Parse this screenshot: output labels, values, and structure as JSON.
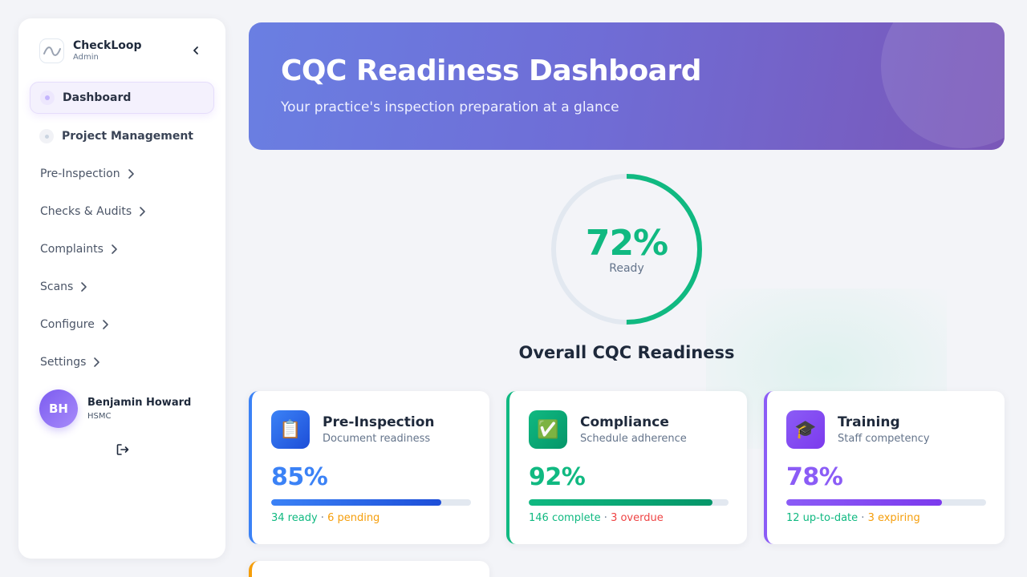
{
  "app": {
    "name": "CheckLoop",
    "role": "Admin",
    "collapse_icon": "chevron-left-icon"
  },
  "nav": {
    "primary": [
      {
        "label": "Dashboard",
        "active": true
      },
      {
        "label": "Project Management",
        "active": false
      }
    ],
    "groups": [
      {
        "label": "Pre-Inspection"
      },
      {
        "label": "Checks & Audits"
      },
      {
        "label": "Complaints"
      },
      {
        "label": "Scans"
      },
      {
        "label": "Configure"
      },
      {
        "label": "Settings"
      }
    ]
  },
  "user": {
    "initials": "BH",
    "name": "Benjamin Howard",
    "role": "HSMC",
    "logout_icon": "logout-icon"
  },
  "banner": {
    "title": "CQC Readiness Dashboard",
    "subtitle": "Your practice's inspection preparation at a glance"
  },
  "readiness": {
    "value": "72%",
    "fraction": 0.5,
    "label": "Ready",
    "title": "Overall CQC Readiness",
    "color": "#10b981",
    "track_color": "#e2e8f0"
  },
  "cards": [
    {
      "title": "Pre-Inspection",
      "subtitle": "Document readiness",
      "icon": "clipboard-icon",
      "glyph": "📋",
      "percent": "85%",
      "progress": 0.85,
      "accent": "#3b82f6",
      "gradient": [
        "#3b82f6",
        "#1d4ed8"
      ],
      "stat_good": "34 ready",
      "stat_sep": " · ",
      "stat_other": "6 pending",
      "stat_other_kind": "warn"
    },
    {
      "title": "Compliance",
      "subtitle": "Schedule adherence",
      "icon": "check-mark-icon",
      "glyph": "✅",
      "percent": "92%",
      "progress": 0.92,
      "accent": "#10b981",
      "gradient": [
        "#10b981",
        "#059669"
      ],
      "stat_good": "146 complete",
      "stat_sep": " · ",
      "stat_other": "3 overdue",
      "stat_other_kind": "bad"
    },
    {
      "title": "Training",
      "subtitle": "Staff competency",
      "icon": "graduation-cap-icon",
      "glyph": "🎓",
      "percent": "78%",
      "progress": 0.78,
      "accent": "#8b5cf6",
      "gradient": [
        "#8b5cf6",
        "#7c3aed"
      ],
      "stat_good": "12 up-to-date",
      "stat_sep": " · ",
      "stat_other": "3 expiring",
      "stat_other_kind": "warn"
    }
  ],
  "partial_card": {
    "accent": "#f59e0b"
  }
}
